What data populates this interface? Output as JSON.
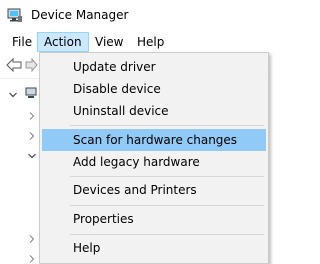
{
  "window": {
    "title": "Device Manager"
  },
  "menubar": {
    "items": [
      "File",
      "Action",
      "View",
      "Help"
    ],
    "active": "Action"
  },
  "action_menu": {
    "items": [
      "Update driver",
      "Disable device",
      "Uninstall device",
      "Scan for hardware changes",
      "Add legacy hardware",
      "Devices and Printers",
      "Properties",
      "Help"
    ],
    "highlighted": "Scan for hardware changes"
  },
  "colors": {
    "menu_highlight": "#91c9f7",
    "active_menu_bg": "#cce8ff",
    "menu_bg": "#f2f2f2"
  }
}
